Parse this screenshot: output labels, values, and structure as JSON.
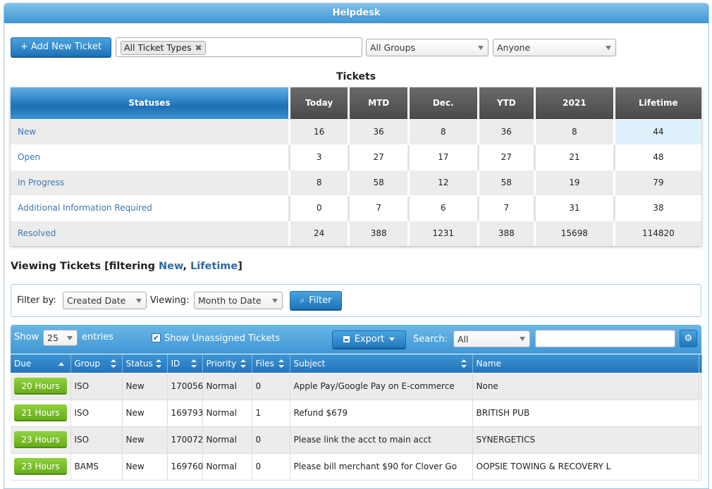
{
  "window": {
    "title": "Helpdesk"
  },
  "toolbar": {
    "add_button": "+ Add New Ticket",
    "ticket_type_chip": "All Ticket Types",
    "groups_select": "All Groups",
    "assignee_select": "Anyone"
  },
  "stats": {
    "caption": "Tickets",
    "header": {
      "statuses": "Statuses",
      "columns": [
        "Today",
        "MTD",
        "Dec.",
        "YTD",
        "2021",
        "Lifetime"
      ]
    },
    "rows": [
      {
        "name": "New",
        "values": [
          "16",
          "36",
          "8",
          "36",
          "8",
          "44"
        ]
      },
      {
        "name": "Open",
        "values": [
          "3",
          "27",
          "17",
          "27",
          "21",
          "48"
        ]
      },
      {
        "name": "In Progress",
        "values": [
          "8",
          "58",
          "12",
          "58",
          "19",
          "79"
        ]
      },
      {
        "name": "Additional Information Required",
        "values": [
          "0",
          "7",
          "6",
          "7",
          "31",
          "38"
        ]
      },
      {
        "name": "Resolved",
        "values": [
          "24",
          "388",
          "1231",
          "388",
          "15698",
          "114820"
        ]
      }
    ]
  },
  "viewing": {
    "prefix": "Viewing Tickets [filtering ",
    "filter1": "New",
    "sep": ", ",
    "filter2": "Lifetime",
    "suffix": "]"
  },
  "filter": {
    "filter_by_label": "Filter by:",
    "filter_by_value": "Created Date",
    "viewing_label": "Viewing:",
    "viewing_value": "Month to Date",
    "filter_button": "Filter"
  },
  "table_controls": {
    "show_label": "Show",
    "entries_value": "25",
    "entries_label": "entries",
    "unassigned_label": "Show Unassigned Tickets",
    "export_button": "Export",
    "search_label": "Search:",
    "search_scope": "All",
    "search_value": ""
  },
  "tickets": {
    "columns": [
      "Due",
      "Group",
      "Status",
      "ID",
      "Priority",
      "Files",
      "Subject",
      "Name"
    ],
    "rows": [
      {
        "due": "20 Hours",
        "group": "ISO",
        "status": "New",
        "id": "170056",
        "priority": "Normal",
        "files": "0",
        "subject": "Apple Pay/Google Pay on E-commerce",
        "name": "None"
      },
      {
        "due": "21 Hours",
        "group": "ISO",
        "status": "New",
        "id": "169793",
        "priority": "Normal",
        "files": "1",
        "subject": "Refund $679",
        "name": "BRITISH PUB"
      },
      {
        "due": "23 Hours",
        "group": "ISO",
        "status": "New",
        "id": "170072",
        "priority": "Normal",
        "files": "0",
        "subject": "Please link the acct to main acct",
        "name": "SYNERGETICS"
      },
      {
        "due": "23 Hours",
        "group": "BAMS",
        "status": "New",
        "id": "169760",
        "priority": "Normal",
        "files": "0",
        "subject": "Please bill merchant $90 for Clover Go",
        "name": "OOPSIE TOWING & RECOVERY L"
      }
    ]
  },
  "colors": {
    "accent_blue": "#2f85c8",
    "link_blue": "#3b78b5",
    "due_green": "#68ad1c",
    "header_dark": "#4a4a4a"
  }
}
